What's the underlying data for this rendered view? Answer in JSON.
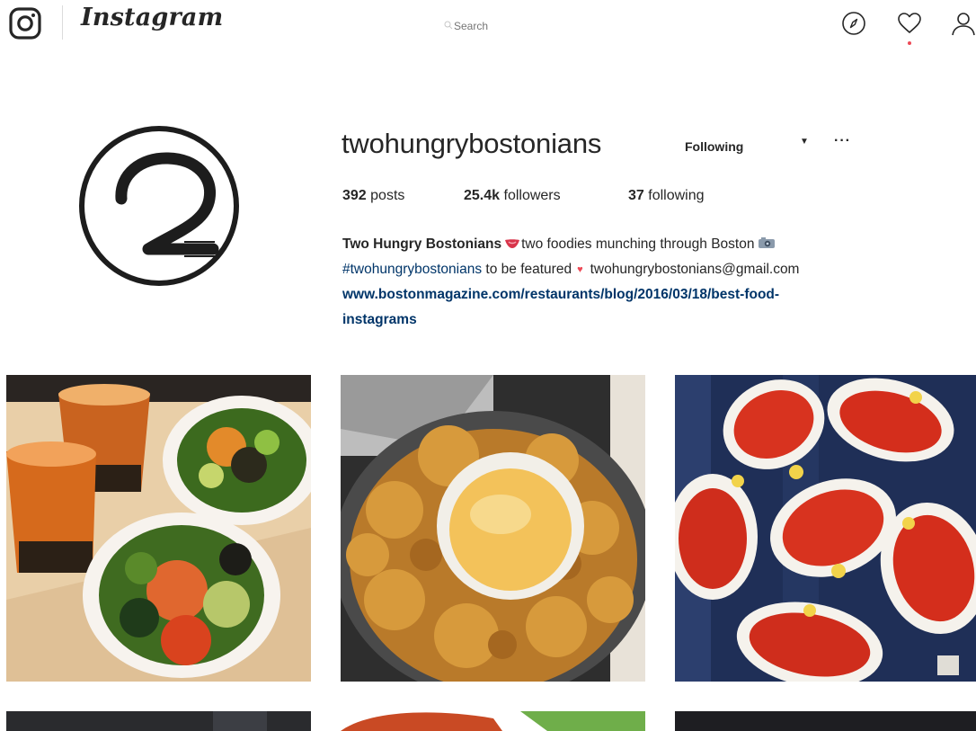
{
  "nav": {
    "brand": "Instagram",
    "search_placeholder": "Search"
  },
  "profile": {
    "username": "twohungrybostonians",
    "follow_label": "Following",
    "more_label": "···",
    "stats": {
      "posts_count": "392",
      "posts_label": "posts",
      "followers_count": "25.4k",
      "followers_label": "followers",
      "following_count": "37",
      "following_label": "following"
    },
    "bio": {
      "name": "Two Hungry Bostonians",
      "tagline": "two foodies munching through Boston",
      "hashtag": "#twohungrybostonians",
      "featured_text": "to be featured",
      "email": "twohungrybostonians@gmail.com",
      "link_line1": "www.bostonmagazine.com/restaurants/blog/2016/03/18/best-food-",
      "link_line2": "instagrams"
    }
  },
  "colors": {
    "link": "#003569",
    "notification": "#ed4956"
  },
  "icons": [
    "instagram-camera-icon",
    "search-icon",
    "compass-icon",
    "heart-icon",
    "user-icon",
    "heart-emoji-icon",
    "mouth-emoji-icon",
    "camera-emoji-icon"
  ],
  "posts": [
    {
      "subject": "poke bowls and thai iced teas"
    },
    {
      "subject": "waffle fries with dipping sauce"
    },
    {
      "subject": "lobsters on plates"
    },
    {
      "subject": ""
    },
    {
      "subject": ""
    },
    {
      "subject": ""
    }
  ]
}
